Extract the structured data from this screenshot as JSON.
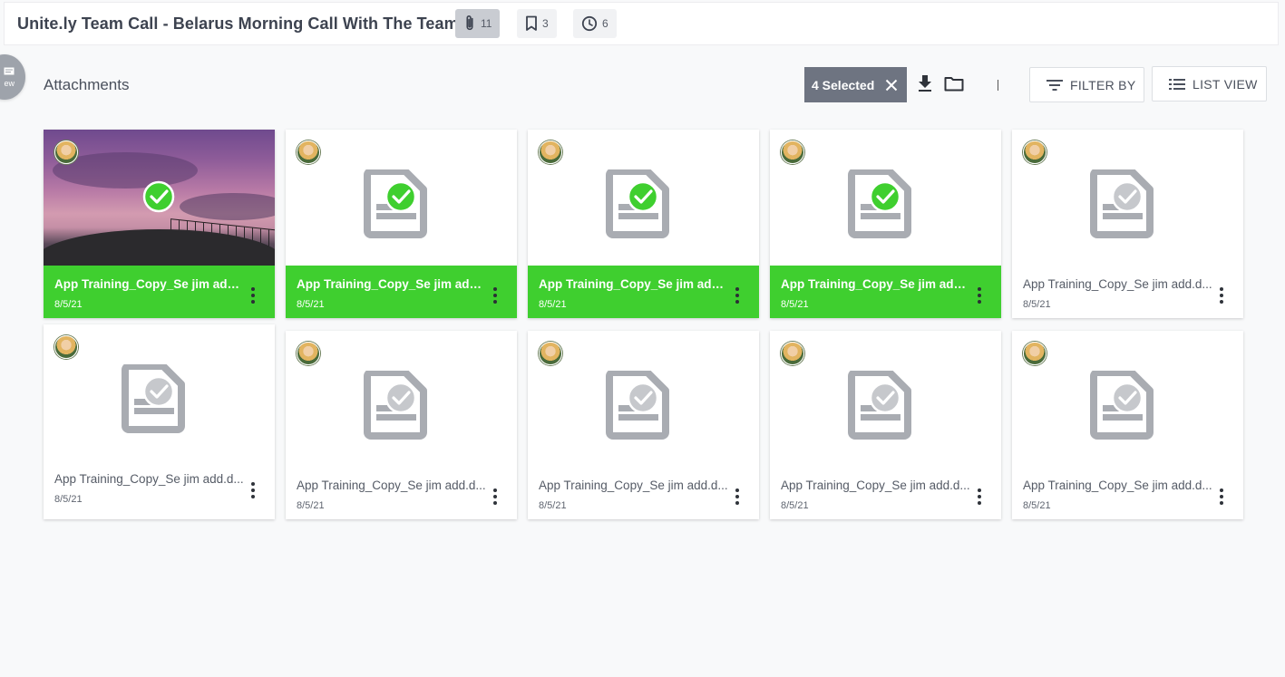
{
  "header": {
    "title": "Unite.ly Team Call - Belarus Morning Call With The Team",
    "badges": [
      {
        "icon": "paperclip-icon",
        "count": "11",
        "active": true
      },
      {
        "icon": "bookmark-icon",
        "count": "3",
        "active": false
      },
      {
        "icon": "clock-icon",
        "count": "6",
        "active": false
      }
    ]
  },
  "side_tab": {
    "label": "ew",
    "icon": "comment-icon"
  },
  "main": {
    "section_title": "Attachments",
    "toolbar": {
      "selected_label": "4 Selected",
      "filter_label": "FILTER BY",
      "list_view_label": "LIST VIEW"
    }
  },
  "colors": {
    "selected_green": "#3fcf2f",
    "check_green": "#3fcf2f",
    "doc_gray": "#a9acb2"
  },
  "attachments": [
    {
      "name": "App Training_Copy_Se jim add.d...",
      "date": "8/5/21",
      "selected": true,
      "thumbnail": "photo"
    },
    {
      "name": "App Training_Copy_Se jim add.d...",
      "date": "8/5/21",
      "selected": true,
      "thumbnail": "document"
    },
    {
      "name": "App Training_Copy_Se jim add.d...",
      "date": "8/5/21",
      "selected": true,
      "thumbnail": "document"
    },
    {
      "name": "App Training_Copy_Se jim add.d...",
      "date": "8/5/21",
      "selected": true,
      "thumbnail": "document"
    },
    {
      "name": "App Training_Copy_Se jim add.d...",
      "date": "8/5/21",
      "selected": false,
      "thumbnail": "document"
    },
    {
      "name": "App Training_Copy_Se jim add.d...",
      "date": "8/5/21",
      "selected": false,
      "thumbnail": "document"
    },
    {
      "name": "App Training_Copy_Se jim add.d...",
      "date": "8/5/21",
      "selected": false,
      "thumbnail": "document"
    },
    {
      "name": "App Training_Copy_Se jim add.d...",
      "date": "8/5/21",
      "selected": false,
      "thumbnail": "document"
    },
    {
      "name": "App Training_Copy_Se jim add.d...",
      "date": "8/5/21",
      "selected": false,
      "thumbnail": "document"
    },
    {
      "name": "App Training_Copy_Se jim add.d...",
      "date": "8/5/21",
      "selected": false,
      "thumbnail": "document"
    }
  ]
}
